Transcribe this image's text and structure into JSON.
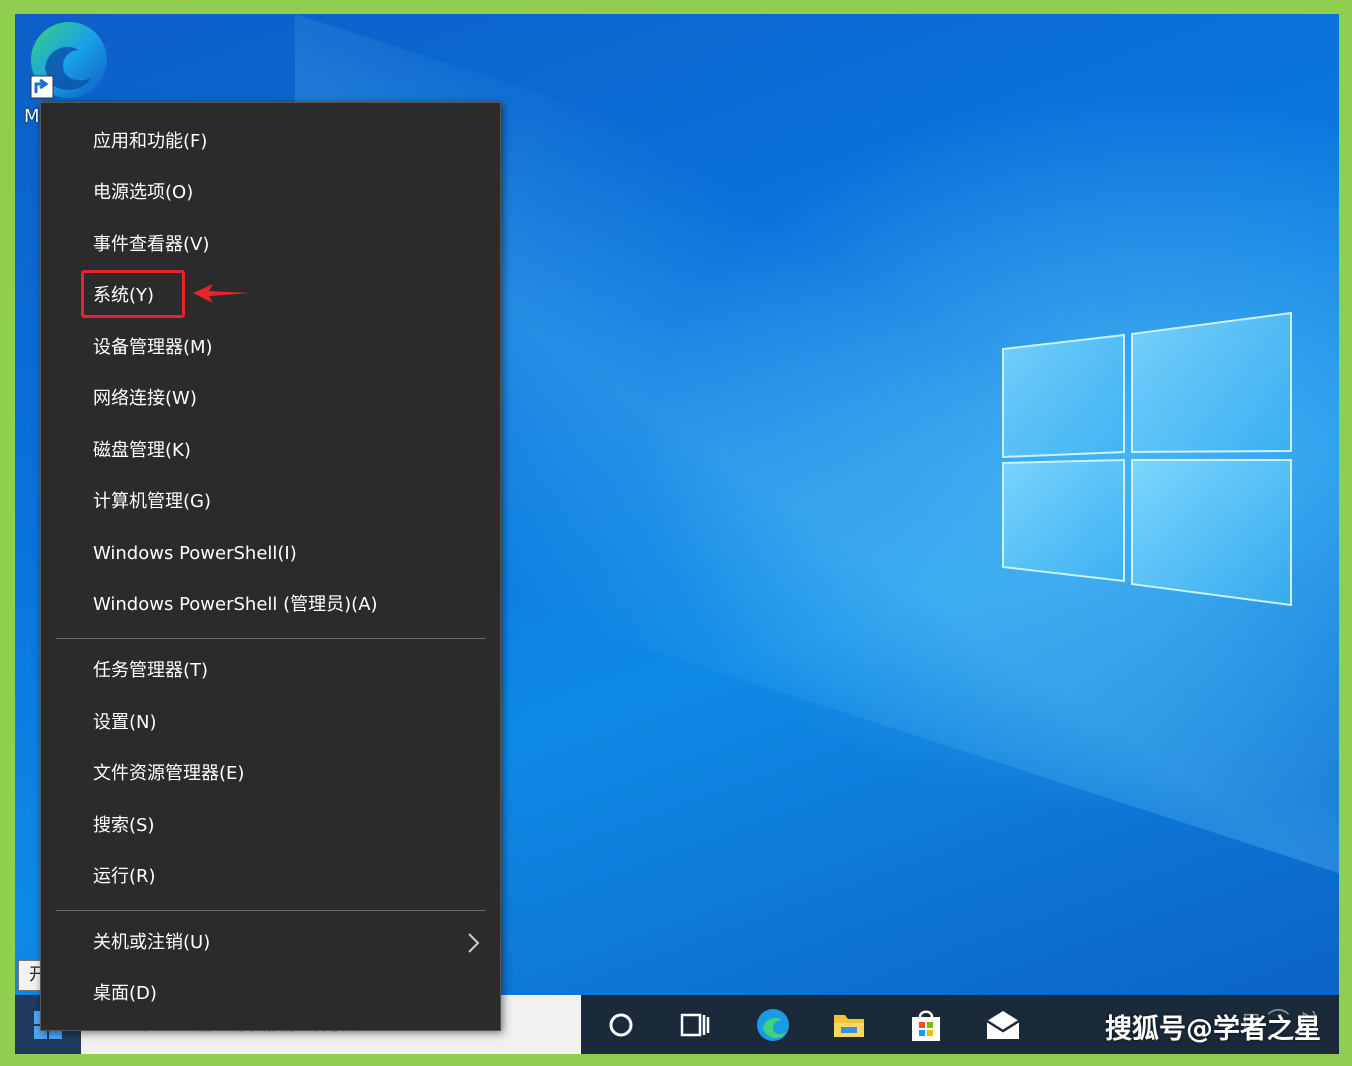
{
  "desktop": {
    "icon_label": "M"
  },
  "context_menu": {
    "items": [
      {
        "label": "应用和功能(F)"
      },
      {
        "label": "电源选项(O)"
      },
      {
        "label": "事件查看器(V)"
      },
      {
        "label": "系统(Y)",
        "highlighted": true
      },
      {
        "label": "设备管理器(M)"
      },
      {
        "label": "网络连接(W)"
      },
      {
        "label": "磁盘管理(K)"
      },
      {
        "label": "计算机管理(G)"
      },
      {
        "label": "Windows PowerShell(I)"
      },
      {
        "label": "Windows PowerShell (管理员)(A)"
      },
      {
        "label": "任务管理器(T)"
      },
      {
        "label": "设置(N)"
      },
      {
        "label": "文件资源管理器(E)"
      },
      {
        "label": "搜索(S)"
      },
      {
        "label": "运行(R)"
      },
      {
        "label": "关机或注销(U)",
        "has_submenu": true
      },
      {
        "label": "桌面(D)"
      }
    ]
  },
  "tooltip": {
    "start_label": "开始"
  },
  "taskbar": {
    "search_placeholder": "在这里输入你要搜索的内容",
    "icons": [
      "cortana-icon",
      "task-view-icon",
      "edge-icon",
      "file-explorer-icon",
      "store-icon",
      "mail-icon"
    ]
  },
  "watermark": "搜狐号@学者之星",
  "colors": {
    "highlight": "#e8242b",
    "menu_bg": "#2b2b2b",
    "frame": "#8fce4f"
  }
}
